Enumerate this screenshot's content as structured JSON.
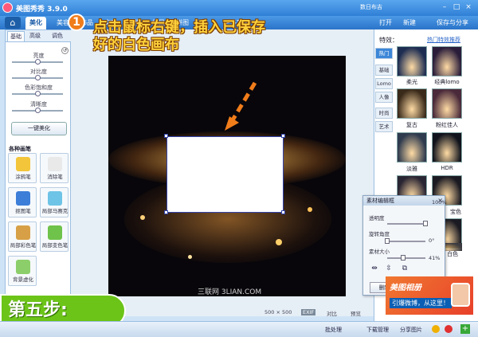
{
  "titlebar": {
    "app_title": "美图秀秀 3.9.0",
    "menu": "数日布吉",
    "minimize": "–",
    "maximize": "□",
    "close": "×"
  },
  "toolbar": {
    "tabs": [
      "美化",
      "美容",
      "饰品",
      "文字",
      "边框",
      "场景",
      "拼图",
      "更多功能"
    ],
    "open": "打开",
    "new": "新建",
    "save_share": "保存与分享"
  },
  "left_panel": {
    "tabs": [
      "基础",
      "高级",
      "调色"
    ],
    "sliders": [
      {
        "label": "亮度",
        "value": 0.5
      },
      {
        "label": "对比度",
        "value": 0.5
      },
      {
        "label": "色彩饱和度",
        "value": 0.5
      },
      {
        "label": "清晰度",
        "value": 0.5
      }
    ],
    "one_key_button": "一键美化",
    "section_title": "各种画笔",
    "tools": [
      {
        "label": "涂鸦笔",
        "color": "#f3c53a"
      },
      {
        "label": "消除笔",
        "color": "#e9e9e9"
      },
      {
        "label": "抠图笔",
        "color": "#3d7ed8"
      },
      {
        "label": "局部马赛克",
        "color": "#6ec4e6"
      },
      {
        "label": "局部彩色笔",
        "color": "#d7a046"
      },
      {
        "label": "局部变色笔",
        "color": "#6fc24a"
      },
      {
        "label": "背景虚化",
        "color": "#8ccf6a"
      }
    ]
  },
  "annotation": {
    "badge": "1",
    "line1": "点击鼠标右键，插入已保存",
    "line2": "好的白色画布"
  },
  "canvas": {
    "watermark": "三联网 3LIAN.COM",
    "size_text": "500 × 500",
    "exif": "EXIF",
    "compare": "对比",
    "preview": "预览"
  },
  "right_panel": {
    "title": "特效：",
    "link": "热门特效推荐",
    "tabs": [
      "热门",
      "基础",
      "Lomo",
      "人像",
      "时尚",
      "艺术"
    ],
    "effects": [
      {
        "label": "柔光",
        "color": "#1d2d52"
      },
      {
        "label": "经典lomo",
        "color": "#2a1d3a"
      },
      {
        "label": "复古",
        "color": "#3a2a1a"
      },
      {
        "label": "粉红佳人",
        "color": "#4a2a3a"
      },
      {
        "label": "淡雅",
        "color": "#2e3a4e"
      },
      {
        "label": "HDR",
        "color": "#10131c"
      },
      {
        "label": "",
        "color": "#2a2533"
      },
      {
        "label": "宝色",
        "color": "#1b1a22"
      },
      {
        "label": "",
        "color": "#1b1a22"
      },
      {
        "label": "白色",
        "color": "#3a3a40"
      }
    ]
  },
  "popup": {
    "title": "素材编辑框",
    "close": "×",
    "rows": [
      {
        "label": "透明度",
        "value_text": "100%",
        "value": 1.0
      },
      {
        "label": "旋转角度",
        "value_text": "0°",
        "value": 0.0
      },
      {
        "label": "素材大小",
        "value_text": "41%",
        "value": 0.41
      }
    ],
    "delete_button": "删除本素材"
  },
  "promo": {
    "line1": "美图相册",
    "line2": "引爆微博，从这里！"
  },
  "step_banner": "第五步:",
  "statusbar": {
    "batch": "批处理",
    "download": "下载管理",
    "share": "分享图片"
  }
}
